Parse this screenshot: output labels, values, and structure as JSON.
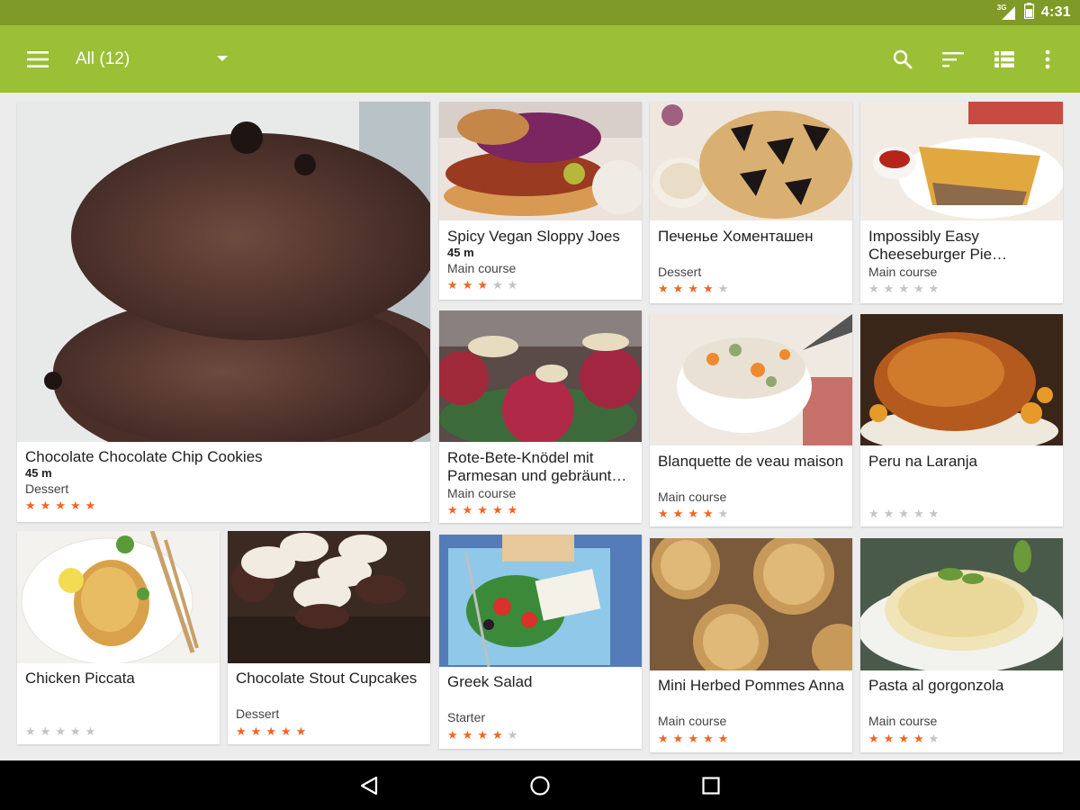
{
  "status_bar": {
    "time": "4:31",
    "network": "3G"
  },
  "toolbar": {
    "menu_icon": "hamburger-menu-icon",
    "filter_label": "All (12)",
    "actions": [
      "search-icon",
      "sort-icon",
      "list-view-icon",
      "overflow-menu-icon"
    ]
  },
  "colors": {
    "status_bar": "#7f9a26",
    "toolbar": "#9bbf35",
    "star_on": "#f26522",
    "star_off": "#c4c4c4",
    "background": "#ececec"
  },
  "recipes": [
    {
      "title": "Chocolate Chocolate Chip Cookies",
      "time": "45 m",
      "category": "Dessert",
      "rating": 5
    },
    {
      "title": "Spicy Vegan Sloppy Joes",
      "time": "45 m",
      "category": "Main course",
      "rating": 3
    },
    {
      "title": "Печенье Хоменташен",
      "time": "",
      "category": "Dessert",
      "rating": 4
    },
    {
      "title": "Impossibly Easy Cheeseburger Pie…",
      "time": "",
      "category": "Main course",
      "rating": 0
    },
    {
      "title": "Rote-Bete-Knödel mit Parmesan und gebräunt…",
      "time": "",
      "category": "Main course",
      "rating": 5
    },
    {
      "title": "Blanquette de veau maison",
      "time": "",
      "category": "Main course",
      "rating": 4
    },
    {
      "title": "Peru na Laranja",
      "time": "",
      "category": "",
      "rating": 0
    },
    {
      "title": "Chicken Piccata",
      "time": "",
      "category": "",
      "rating": 0
    },
    {
      "title": "Chocolate Stout Cupcakes",
      "time": "",
      "category": "Dessert",
      "rating": 5
    },
    {
      "title": "Greek Salad",
      "time": "",
      "category": "Starter",
      "rating": 4
    },
    {
      "title": "Mini Herbed Pommes Anna",
      "time": "",
      "category": "Main course",
      "rating": 5
    },
    {
      "title": "Pasta al gorgonzola",
      "time": "",
      "category": "Main course",
      "rating": 4
    }
  ],
  "nav_bar": [
    "back-icon",
    "home-icon",
    "recents-icon"
  ]
}
